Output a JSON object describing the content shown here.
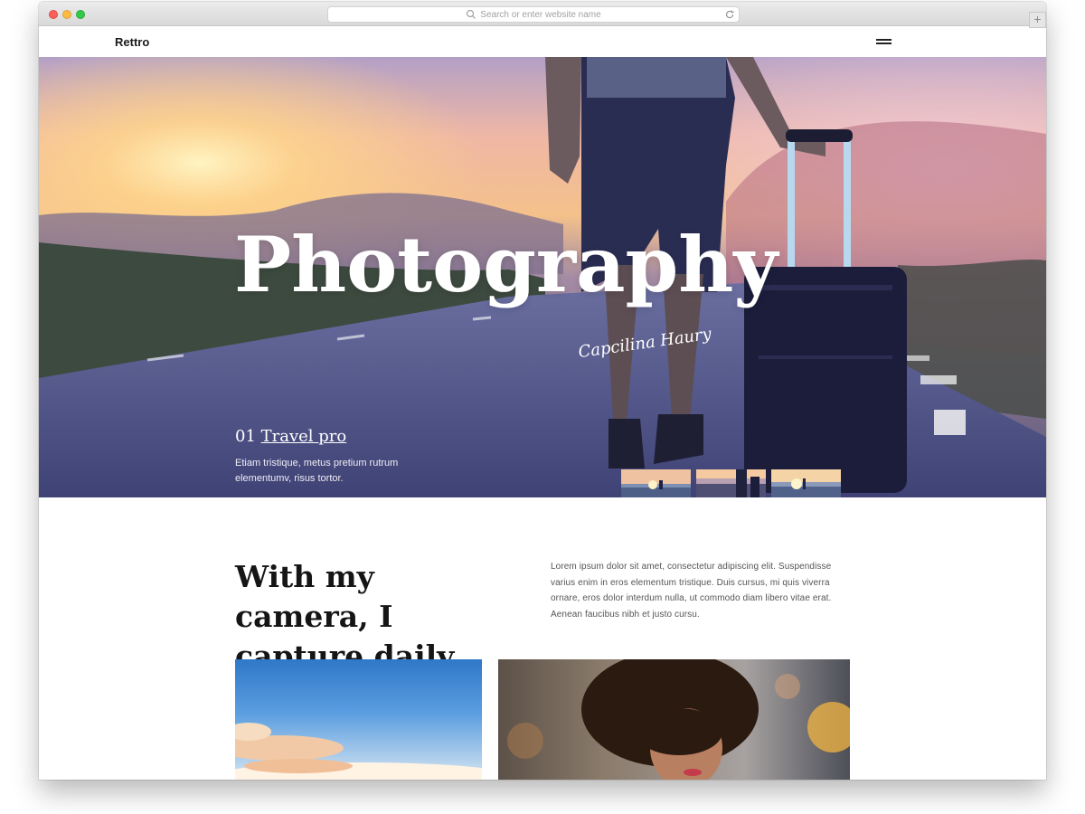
{
  "browser": {
    "address_placeholder": "Search or enter website name"
  },
  "site": {
    "logo": "Rettro"
  },
  "hero": {
    "title": "Photography",
    "signature": "Capcilina Haury",
    "slide_number": "01",
    "slide_title": "Travel pro",
    "slide_text": "Etiam tristique, metus pretium rutrum elementumv, risus tortor.",
    "thumbnails": [
      "thumbnail-1",
      "thumbnail-2",
      "thumbnail-3"
    ]
  },
  "intro": {
    "heading": "With my camera, I capture daily life",
    "text": "Lorem ipsum dolor sit amet, consectetur adipiscing elit. Suspendisse varius enim in eros elementum tristique. Duis cursus, mi quis viverra ornare, eros dolor interdum nulla, ut commodo diam libero vitae erat. Aenean faucibus nibh et justo cursu."
  },
  "icons": {
    "search": "search-icon",
    "reload": "reload-icon",
    "menu": "menu-icon",
    "add": "plus-icon"
  },
  "colors": {
    "heading": "#151515",
    "body_text": "#555555",
    "hero_text": "#ffffff"
  }
}
